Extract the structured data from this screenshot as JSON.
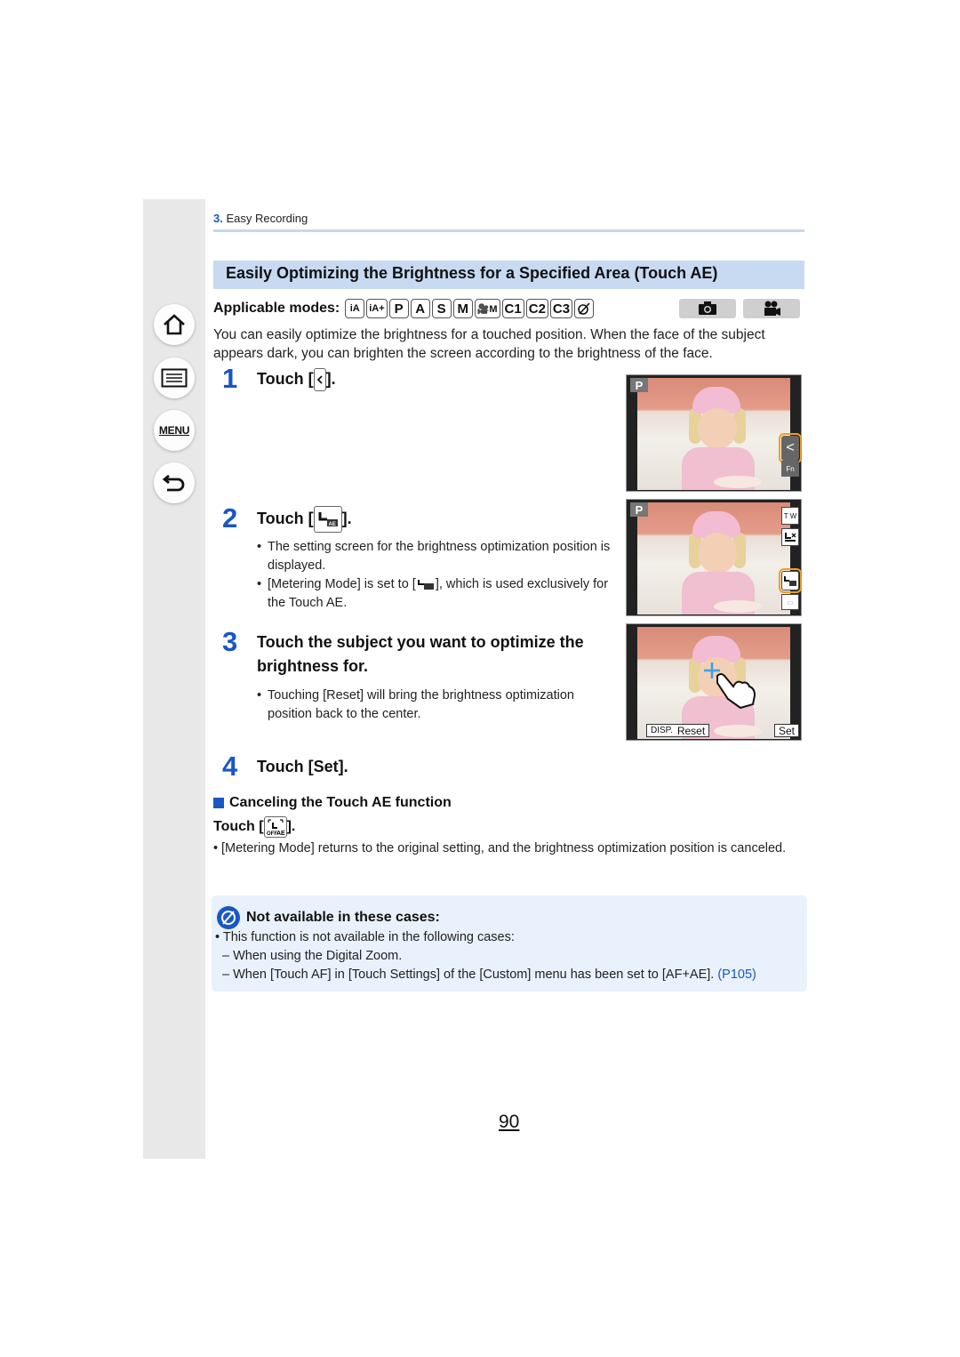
{
  "sidebar": {
    "items": [
      {
        "name": "home",
        "icon": "home-icon"
      },
      {
        "name": "contents",
        "icon": "list-icon"
      },
      {
        "name": "menu",
        "label": "MENU"
      },
      {
        "name": "back",
        "icon": "return-icon"
      }
    ]
  },
  "breadcrumb": {
    "number": "3.",
    "label": "Easy Recording"
  },
  "section": {
    "title": "Easily Optimizing the Brightness for a Specified Area (Touch AE)"
  },
  "modes": {
    "label": "Applicable modes:",
    "items": [
      "iA",
      "iA+",
      "P",
      "A",
      "S",
      "M",
      "🎥M",
      "C1",
      "C2",
      "C3",
      "SCN"
    ],
    "recording": [
      "camera-icon",
      "movie-camera-icon"
    ]
  },
  "intro": "You can easily optimize the brightness for a touched position. When the face of the subject appears dark, you can brighten the screen according to the brightness of the face.",
  "steps": [
    {
      "number": "1",
      "title_prefix": "Touch [",
      "title_suffix": "].",
      "icon": "tab-open-icon",
      "bullets": []
    },
    {
      "number": "2",
      "title_prefix": "Touch [",
      "title_suffix": "].",
      "icon": "touch-ae-icon",
      "bullets": [
        "The setting screen for the brightness optimization position is displayed.",
        {
          "prefix": "[Metering Mode] is set to [",
          "suffix": "], which is used exclusively for the Touch AE."
        }
      ]
    },
    {
      "number": "3",
      "title": "Touch the subject you want to optimize the brightness for.",
      "bullets": [
        "Touching [Reset] will bring the brightness optimization position back to the center."
      ]
    },
    {
      "number": "4",
      "title": "Touch [Set]."
    }
  ],
  "screens": [
    {
      "mode": "P",
      "controls": [
        "<",
        "Fn"
      ]
    },
    {
      "mode": "P",
      "controls": [
        "T W",
        "touch-off",
        "touch-ae",
        "Fn"
      ]
    },
    {
      "buttons": {
        "disp": "DISP.",
        "reset": "Reset",
        "set": "Set"
      }
    }
  ],
  "cancel": {
    "heading": "Canceling the Touch AE function",
    "touch_prefix": "Touch [",
    "touch_suffix": "].",
    "note": "[Metering Mode] returns to the original setting, and the brightness optimization position is canceled."
  },
  "notice": {
    "heading": "Not available in these cases:",
    "intro": "• This function is not available in the following cases:",
    "cases": [
      "– When using the Digital Zoom.",
      "– When [Touch AF] in [Touch Settings] of the [Custom] menu has been set to [AF+AE]. "
    ],
    "link": "(P105)"
  },
  "page_number": "90",
  "colors": {
    "accent": "#1a56c4",
    "title_bg": "#c8daf1",
    "notice_bg": "#e8f1fc",
    "highlight": "#f0a020"
  }
}
